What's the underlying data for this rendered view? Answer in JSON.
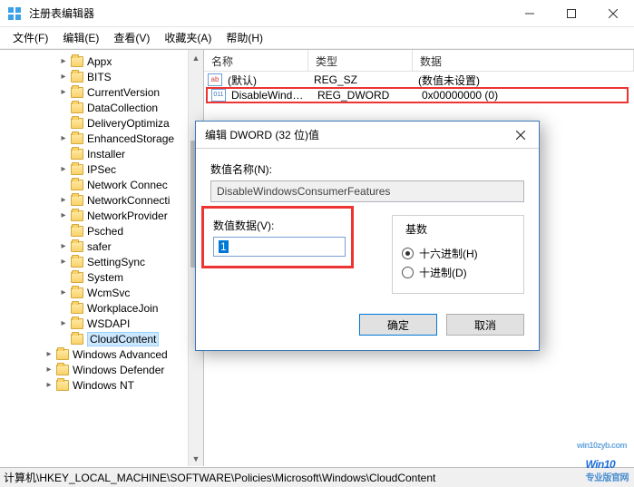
{
  "window": {
    "title": "注册表编辑器"
  },
  "menu": {
    "file": "文件(F)",
    "edit": "编辑(E)",
    "view": "查看(V)",
    "favorites": "收藏夹(A)",
    "help": "帮助(H)"
  },
  "tree": {
    "items": [
      {
        "label": "Appx",
        "indent": 4,
        "expander": "+"
      },
      {
        "label": "BITS",
        "indent": 4,
        "expander": "+"
      },
      {
        "label": "CurrentVersion",
        "indent": 4,
        "expander": "+"
      },
      {
        "label": "DataCollection",
        "indent": 4,
        "expander": ""
      },
      {
        "label": "DeliveryOptimiza",
        "indent": 4,
        "expander": ""
      },
      {
        "label": "EnhancedStorage",
        "indent": 4,
        "expander": "+"
      },
      {
        "label": "Installer",
        "indent": 4,
        "expander": ""
      },
      {
        "label": "IPSec",
        "indent": 4,
        "expander": "+"
      },
      {
        "label": "Network Connec",
        "indent": 4,
        "expander": ""
      },
      {
        "label": "NetworkConnecti",
        "indent": 4,
        "expander": "+"
      },
      {
        "label": "NetworkProvider",
        "indent": 4,
        "expander": "+"
      },
      {
        "label": "Psched",
        "indent": 4,
        "expander": ""
      },
      {
        "label": "safer",
        "indent": 4,
        "expander": "+"
      },
      {
        "label": "SettingSync",
        "indent": 4,
        "expander": "+"
      },
      {
        "label": "System",
        "indent": 4,
        "expander": ""
      },
      {
        "label": "WcmSvc",
        "indent": 4,
        "expander": "+"
      },
      {
        "label": "WorkplaceJoin",
        "indent": 4,
        "expander": ""
      },
      {
        "label": "WSDAPI",
        "indent": 4,
        "expander": "+"
      },
      {
        "label": "CloudContent",
        "indent": 4,
        "expander": "",
        "selected": true
      },
      {
        "label": "Windows Advanced",
        "indent": 3,
        "expander": "+"
      },
      {
        "label": "Windows Defender",
        "indent": 3,
        "expander": "+"
      },
      {
        "label": "Windows NT",
        "indent": 3,
        "expander": "+"
      }
    ]
  },
  "list": {
    "headers": {
      "name": "名称",
      "type": "类型",
      "data": "数据"
    },
    "rows": [
      {
        "icon": "ab",
        "name": "(默认)",
        "type": "REG_SZ",
        "data": "(数值未设置)"
      },
      {
        "icon": "num",
        "name": "DisableWindo...",
        "type": "REG_DWORD",
        "data": "0x00000000 (0)",
        "highlight": true
      }
    ]
  },
  "dialog": {
    "title": "编辑 DWORD (32 位)值",
    "name_label": "数值名称(N):",
    "name_value": "DisableWindowsConsumerFeatures",
    "value_label": "数值数据(V):",
    "value_data": "1",
    "radix_label": "基数",
    "radix_hex": "十六进制(H)",
    "radix_dec": "十进制(D)",
    "ok": "确定",
    "cancel": "取消"
  },
  "statusbar": {
    "path": "计算机\\HKEY_LOCAL_MACHINE\\SOFTWARE\\Policies\\Microsoft\\Windows\\CloudContent"
  },
  "watermark": {
    "brand": "Win10",
    "sub": "专业版官网",
    "url": "win10zyb.com"
  }
}
